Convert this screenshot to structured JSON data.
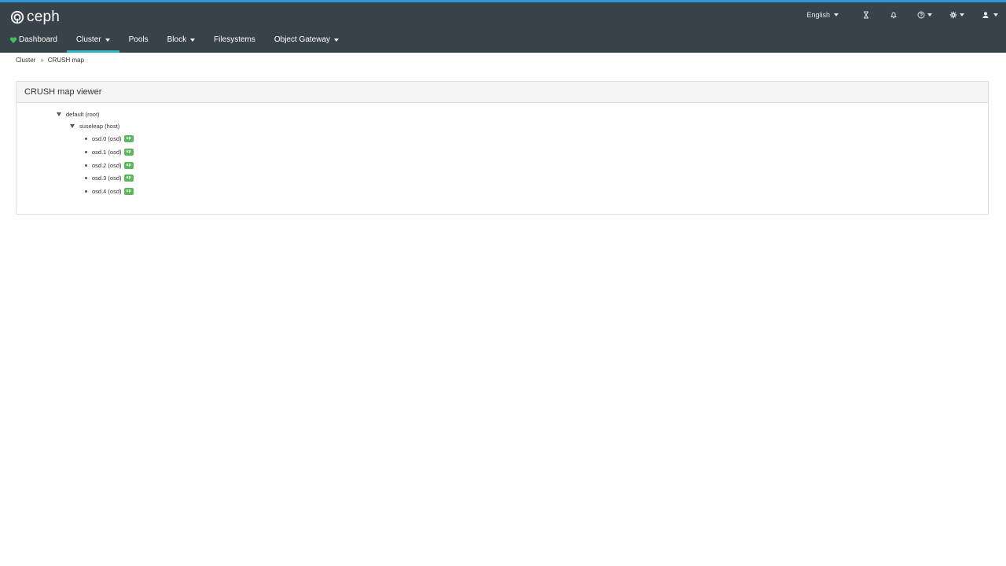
{
  "brand": {
    "name": "ceph"
  },
  "utility": {
    "language": "English",
    "icons": [
      "hourglass-icon",
      "bell-icon",
      "help-icon",
      "gear-icon",
      "user-icon"
    ]
  },
  "nav": {
    "dashboard": "Dashboard",
    "cluster": "Cluster",
    "pools": "Pools",
    "block": "Block",
    "filesystems": "Filesystems",
    "object_gateway": "Object Gateway"
  },
  "breadcrumb": {
    "parent": "Cluster",
    "current": "CRUSH map"
  },
  "panel": {
    "title": "CRUSH map viewer"
  },
  "tree": {
    "root": {
      "label": "default (root)"
    },
    "host": {
      "label": "suseleap (host)"
    },
    "osds": [
      {
        "label": "osd.0 (osd)",
        "status": "up"
      },
      {
        "label": "osd.1 (osd)",
        "status": "up"
      },
      {
        "label": "osd.2 (osd)",
        "status": "up"
      },
      {
        "label": "osd.3 (osd)",
        "status": "up"
      },
      {
        "label": "osd.4 (osd)",
        "status": "up"
      }
    ]
  },
  "colors": {
    "navbar": "#374249",
    "accent_top": "#2b99d9",
    "active_tab": "#2bb3c0",
    "status_up": "#5cb85c"
  }
}
